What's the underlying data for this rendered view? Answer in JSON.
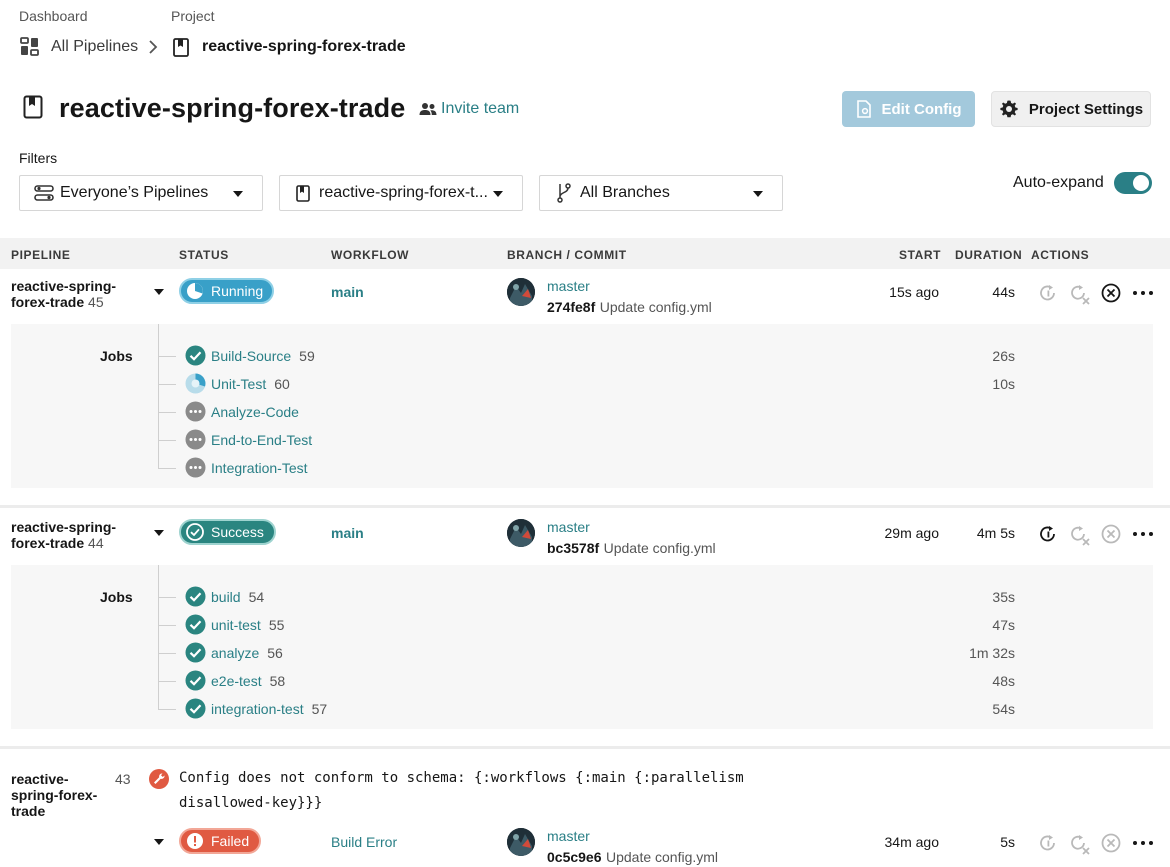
{
  "breadcrumb": {
    "dashboard_label": "Dashboard",
    "project_label": "Project",
    "all_pipelines": "All Pipelines",
    "current_project": "reactive-spring-forex-trade"
  },
  "header": {
    "title": "reactive-spring-forex-trade",
    "invite_team": "Invite team",
    "edit_config": "Edit Config",
    "project_settings": "Project Settings"
  },
  "filters": {
    "label": "Filters",
    "pipelines_filter": "Everyone’s Pipelines",
    "project_filter": "reactive-spring-forex-t...",
    "branch_filter": "All Branches",
    "auto_expand_label": "Auto-expand",
    "auto_expand_on": true
  },
  "table": {
    "headers": {
      "pipeline": "PIPELINE",
      "status": "STATUS",
      "workflow": "WORKFLOW",
      "branch_commit": "BRANCH / COMMIT",
      "start": "START",
      "duration": "DURATION",
      "actions": "ACTIONS"
    },
    "jobs_label": "Jobs",
    "pipelines": [
      {
        "name_line1": "reactive-spring-",
        "name_line2": "forex-trade",
        "number": "45",
        "status": "Running",
        "workflow": "main",
        "branch": "master",
        "sha": "274fe8f",
        "commit_message": "Update config.yml",
        "start": "15s ago",
        "duration": "44s",
        "jobs": [
          {
            "name": "Build-Source",
            "number": "59",
            "duration": "26s",
            "state": "success"
          },
          {
            "name": "Unit-Test",
            "number": "60",
            "duration": "10s",
            "state": "running"
          },
          {
            "name": "Analyze-Code",
            "number": "",
            "duration": "",
            "state": "queued"
          },
          {
            "name": "End-to-End-Test",
            "number": "",
            "duration": "",
            "state": "queued"
          },
          {
            "name": "Integration-Test",
            "number": "",
            "duration": "",
            "state": "queued"
          }
        ]
      },
      {
        "name_line1": "reactive-spring-",
        "name_line2": "forex-trade",
        "number": "44",
        "status": "Success",
        "workflow": "main",
        "branch": "master",
        "sha": "bc3578f",
        "commit_message": "Update config.yml",
        "start": "29m ago",
        "duration": "4m 5s",
        "jobs": [
          {
            "name": "build",
            "number": "54",
            "duration": "35s",
            "state": "success"
          },
          {
            "name": "unit-test",
            "number": "55",
            "duration": "47s",
            "state": "success"
          },
          {
            "name": "analyze",
            "number": "56",
            "duration": "1m 32s",
            "state": "success"
          },
          {
            "name": "e2e-test",
            "number": "58",
            "duration": "48s",
            "state": "success"
          },
          {
            "name": "integration-test",
            "number": "57",
            "duration": "54s",
            "state": "success"
          }
        ]
      },
      {
        "name_line1": "reactive-",
        "name_line2": "spring-forex-",
        "name_line3": "trade",
        "number": "43",
        "error_line1": "Config does not conform to schema: {:workflows {:main {:parallelism",
        "error_line2": "disallowed-key}}}",
        "status": "Failed",
        "workflow": "Build Error",
        "branch": "master",
        "sha": "0c5c9e6",
        "commit_message": "Update config.yml",
        "start": "34m ago",
        "duration": "5s"
      }
    ]
  },
  "colors": {
    "accent_teal": "#2a7f86",
    "running_blue": "#39a0c8",
    "success_teal": "#2a8580",
    "failed_red": "#e05a42",
    "queued_gray": "#8a8a8a"
  },
  "icons": [
    "dashboard-icon",
    "chevron-right-icon",
    "project-icon",
    "people-icon",
    "edit-config-icon",
    "gear-icon",
    "filter-icon",
    "branch-icon",
    "rerun-icon",
    "rerun-failed-icon",
    "cancel-icon",
    "more-icon",
    "check-circle-icon",
    "running-icon",
    "queued-icon",
    "wrench-icon",
    "failed-icon"
  ]
}
